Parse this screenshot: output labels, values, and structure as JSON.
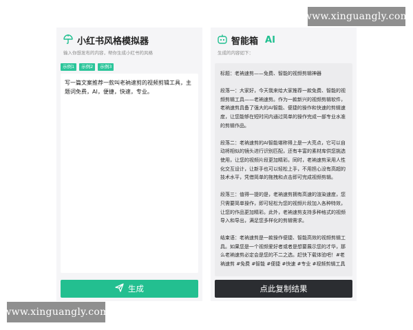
{
  "watermark": {
    "text": "www.xinguangly.com"
  },
  "left_panel": {
    "title": "小红书风格模拟器",
    "subtitle": "输入你想发布的内容，帮你生成小红书的风格",
    "examples": [
      "示例1",
      "示例2",
      "示例3"
    ],
    "input_value": "写一篇文案推荐一款叫老衲速剪的视频剪辑工具，主题词免费，AI，便捷，快速，专业。",
    "generate_label": "生成"
  },
  "right_panel": {
    "title": "智能箱",
    "title_badge": "AI",
    "subtitle": "生成的内容如下：",
    "output_paragraphs": [
      "标题：老衲速剪——免费、智能的视频剪辑神器",
      "段落一：大家好，今天我来给大家推荐一款免费、智能的视频剪辑工具——老衲速剪。作为一款新兴的视频剪辑软件，老衲速剪具备了强大的AI智能、便捷的操作和快速的剪辑速度，让您能够在短时间内通过简单的操作完成一部专业水准的剪辑作品。",
      "段落二：老衲速剪的AI智能堪称得上是一大亮点，它可以自动将相似的镜头进行识别匹配，还有丰富的素材库供您挑选使用，让您的视频片段更加精彩。同时，老衲速剪采用人性化交互设计，让新手也可以轻松上手，不用担心没有高超的技术水平，凭借简单的拖拽和点击即可完成视频剪辑。",
      "段落三：值得一提的是，老衲速剪拥有高速的渲染速度，您只需要简单操作，即可轻松为您的视频片段加入各种特效，让您的作品更加精彩。此外，老衲速剪支持多种格式的视频导入和导出，满足您多样化的剪辑需求。",
      "结束语：老衲速剪是一款操作便捷、智能高效的视频剪辑工具。如果您是一个视频爱好者或者是想要展示您的才华，那么老衲速剪必定会是您的不二之选。赶快下载体验吧！#老衲速剪 #免费 #智能 #便捷 #快速 #专业 #视频剪辑工具"
    ],
    "copy_label": "点此复制结果"
  },
  "colors": {
    "accent": "#23bf90",
    "dark_button": "#2b2d31",
    "panel_bg": "#f5f5f7",
    "watermark_bg": "#8f8f8f"
  },
  "icons": {
    "left_title_icon": "umbrella-icon",
    "right_title_icon": "robot-icon",
    "generate_icon": "send-icon"
  }
}
